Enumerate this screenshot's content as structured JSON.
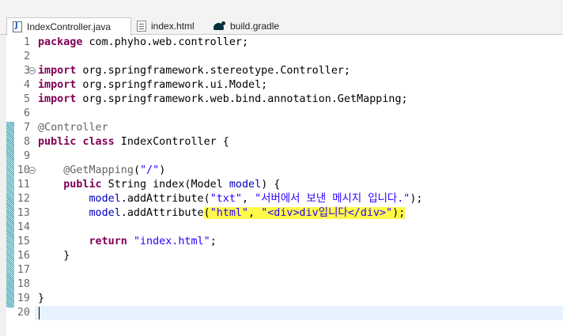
{
  "tabs": [
    {
      "label": "IndexController.java",
      "icon": "java-file-icon",
      "active": true
    },
    {
      "label": "index.html",
      "icon": "html-file-icon",
      "active": false
    },
    {
      "label": "build.gradle",
      "icon": "gradle-icon",
      "active": false
    }
  ],
  "editor": {
    "line_numbers": [
      "1",
      "2",
      "3",
      "4",
      "5",
      "6",
      "7",
      "8",
      "9",
      "10",
      "11",
      "12",
      "13",
      "14",
      "15",
      "16",
      "17",
      "18",
      "19",
      "20"
    ],
    "code": {
      "l1_kw": "package",
      "l1_rest": " com.phyho.web.controller;",
      "l3_kw": "import",
      "l3_rest": " org.springframework.stereotype.Controller;",
      "l4_kw": "import",
      "l4_rest": " org.springframework.ui.Model;",
      "l5_kw": "import",
      "l5_rest": " org.springframework.web.bind.annotation.GetMapping;",
      "l7_ann": "@Controller",
      "l8_kw1": "public",
      "l8_kw2": "class",
      "l8_rest": " IndexController {",
      "l10_ann": "@GetMapping",
      "l10_p1": "(",
      "l10_str": "\"/\"",
      "l10_p2": ")",
      "l11_kw": "public",
      "l11_rest": " String index(Model ",
      "l11_param": "model",
      "l11_end": ") {",
      "l12_obj": "model",
      "l12_call": ".addAttribute(",
      "l12_s1": "\"txt\"",
      "l12_comma": ", ",
      "l12_s2": "\"서버에서 보낸 메시지 입니다.\"",
      "l12_end": ");",
      "l13_obj": "model",
      "l13_call": ".addAttribute",
      "l13_p": "(",
      "l13_s1": "\"html\"",
      "l13_comma": ", ",
      "l13_s2": "\"<div>div입니다</div>\"",
      "l13_end": ");",
      "l15_kw": "return",
      "l15_sp": " ",
      "l15_str": "\"index.html\"",
      "l15_end": ";",
      "l16": "}",
      "l19": "}"
    }
  },
  "colors": {
    "keyword": "#7f0055",
    "string": "#2a00ff",
    "annotation": "#646464",
    "highlight": "#fff94a",
    "current_line": "#e8f2fe"
  }
}
